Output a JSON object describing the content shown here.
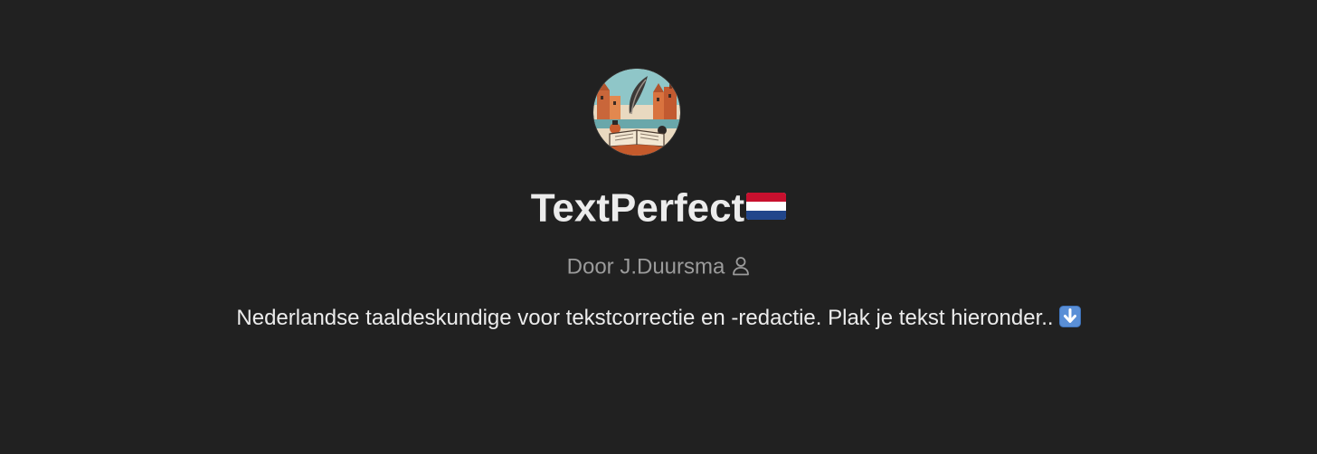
{
  "gpt": {
    "avatar_alt": "TextPerfect avatar",
    "avatar_icon": "book-quill-amsterdam-avatar",
    "title": "TextPerfect",
    "title_emoji": "🇳🇱",
    "author_prefix": "Door",
    "author_name": "J.Duursma",
    "author_label": "Door J.Duursma",
    "author_icon": "person-icon",
    "description": "Nederlandse taaldeskundige voor tekstcorrectie en -redactie. Plak je tekst hieronder..",
    "description_emoji": "⬇️",
    "description_emoji_icon": "down-arrow-icon"
  },
  "colors": {
    "background": "#212121",
    "title_text": "#ececec",
    "author_text": "#9b9b9b",
    "description_text": "#ececec",
    "arrow_box": "#5a8fd6"
  }
}
